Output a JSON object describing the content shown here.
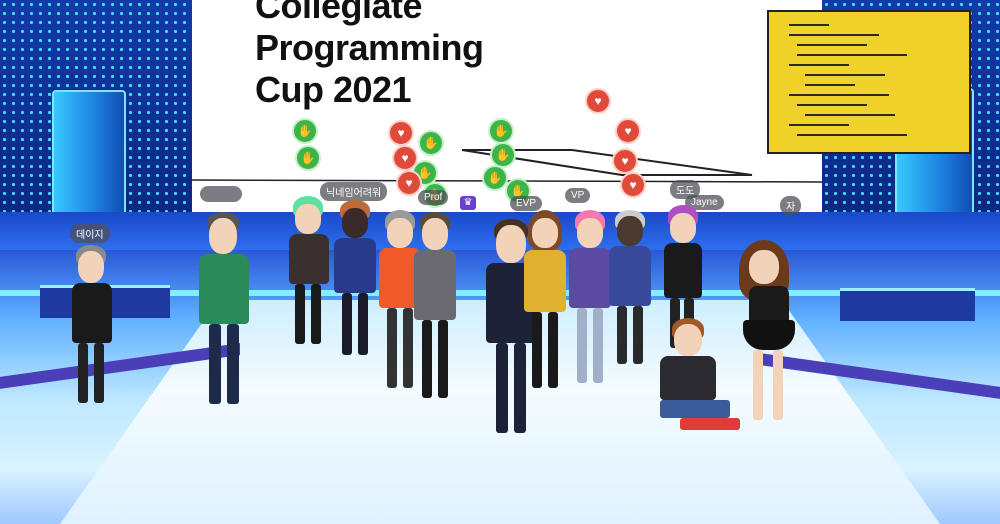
{
  "screen": {
    "title_line1": "Collegiate",
    "title_line2": "Programming",
    "title_line3": "Cup 2021"
  },
  "name_tags": {
    "t1": "",
    "t2": "닉네임어려워",
    "t3": "Prof",
    "t4": "VP",
    "t5": "Jayne",
    "t6": "자",
    "t7": "데이지",
    "t8": "도도",
    "t9": "EVP"
  },
  "reactions": {
    "green_symbol": "✋",
    "red_symbol": "♥"
  },
  "colors": {
    "screen_bg": "#ffffff",
    "laptop_screen": "#f0d22a",
    "led_dot": "#3fe0ff",
    "stage_blue": "#1a3fc0"
  }
}
